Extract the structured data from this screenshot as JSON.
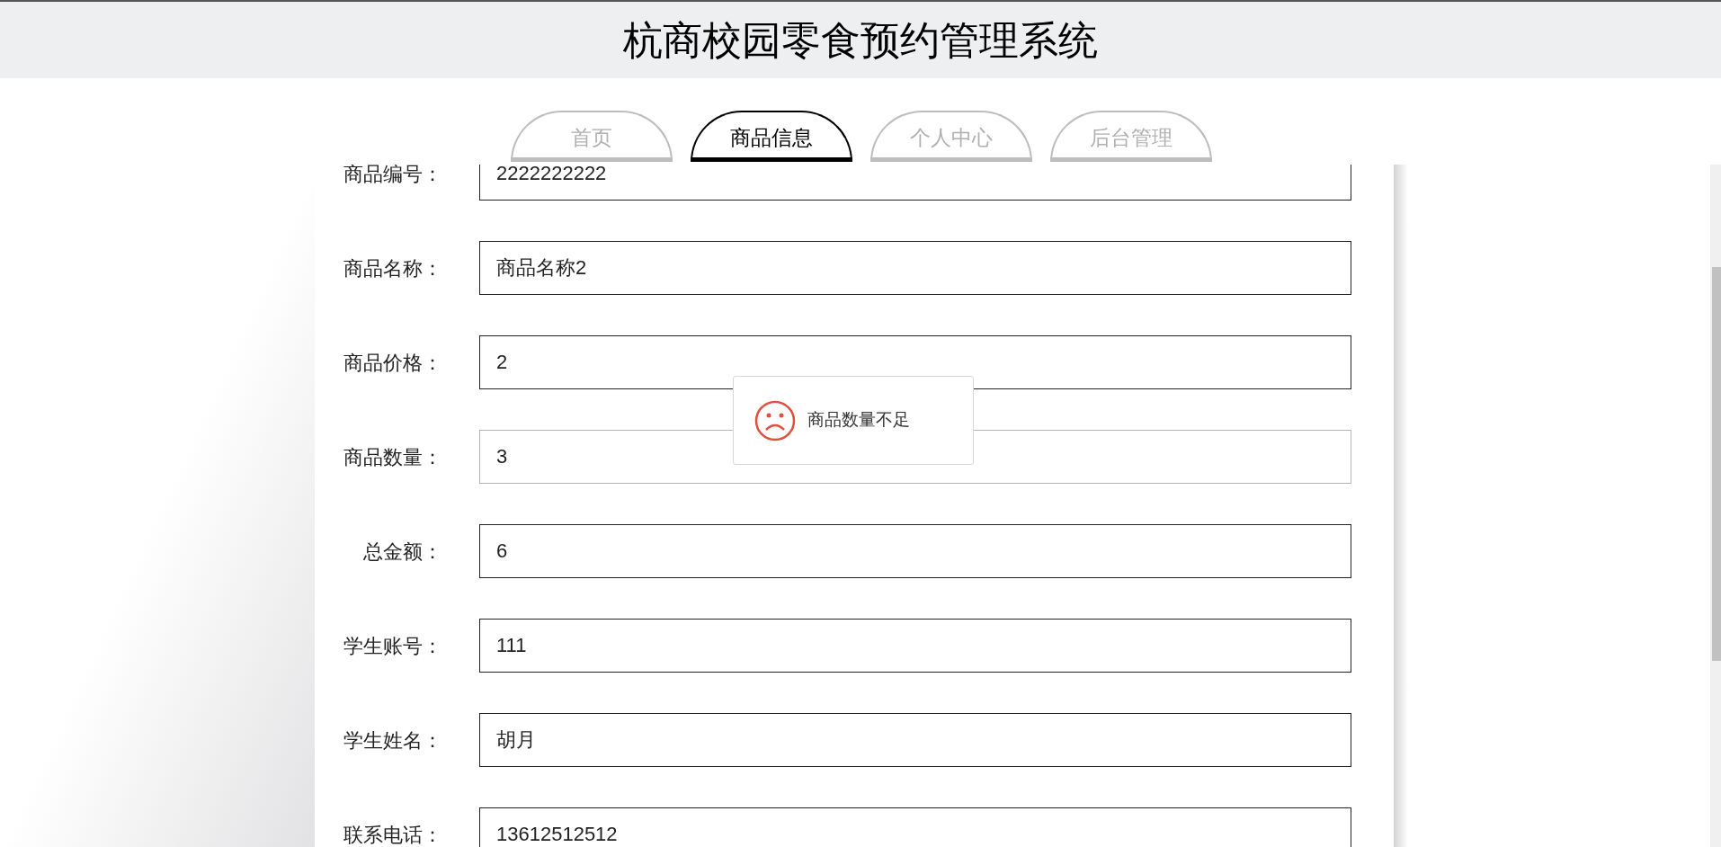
{
  "header": {
    "title": "杭商校园零食预约管理系统"
  },
  "tabs": [
    {
      "label": "首页",
      "selected": false
    },
    {
      "label": "商品信息",
      "selected": true
    },
    {
      "label": "个人中心",
      "selected": false
    },
    {
      "label": "后台管理",
      "selected": false
    }
  ],
  "form": {
    "fields": [
      {
        "label": "商品编号：",
        "value": "2222222222",
        "hovered": false
      },
      {
        "label": "商品名称：",
        "value": "商品名称2",
        "hovered": false
      },
      {
        "label": "商品价格：",
        "value": "2",
        "hovered": false
      },
      {
        "label": "商品数量：",
        "value": "3",
        "hovered": true
      },
      {
        "label": "总金额：",
        "value": "6",
        "hovered": false
      },
      {
        "label": "学生账号：",
        "value": "111",
        "hovered": false
      },
      {
        "label": "学生姓名：",
        "value": "胡月",
        "hovered": false
      },
      {
        "label": "联系电话：",
        "value": "13612512512",
        "hovered": false
      }
    ]
  },
  "toast": {
    "message": "商品数量不足"
  }
}
